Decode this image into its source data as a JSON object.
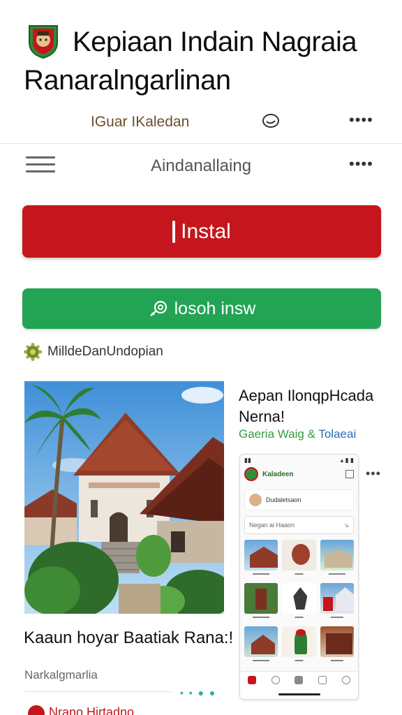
{
  "app": {
    "title_line1": "Kepiaan Indain Nagraia",
    "title_line2": "Ranaralngarlinan",
    "developer": "IGuar IKaledan"
  },
  "toolbar": {
    "title": "Aindanallaing"
  },
  "actions": {
    "install_label": "Instal",
    "open_label": "losoh insw"
  },
  "rating": {
    "text": "MilldeDanUndopian"
  },
  "screenshot_main": {
    "caption": "Kaaun hoyar Baatiak Rana:!",
    "subcaption": "Narkalgmarlia"
  },
  "screenshot_side": {
    "title": "Aepan IlonqpHcada Nerna!",
    "tag_green": "Gaeria Waig &",
    "tag_blue": "Tolaeai",
    "phone_app_name": "Kaladeen",
    "phone_card_text": "Dudaletsaon",
    "phone_search_text": "Negan ai Haaon"
  },
  "footer": {
    "text": "Nrano Hirtadno"
  },
  "icons": {
    "more": "more-horizontal-icon",
    "share": "share-icon",
    "menu": "hamburger-icon"
  },
  "colors": {
    "install": "#c4161c",
    "open": "#23a455",
    "developer": "#6b4d2a"
  }
}
